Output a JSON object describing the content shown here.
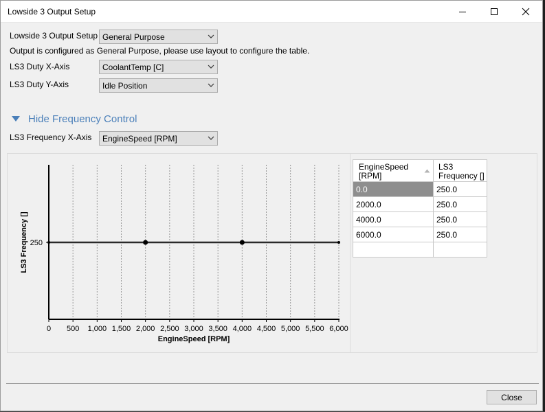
{
  "window": {
    "title": "Lowside 3 Output Setup"
  },
  "form": {
    "output_setup_label": "Lowside 3 Output Setup",
    "output_setup_value": "General Purpose",
    "info_text": "Output is configured as General Purpose, please use layout to configure the table.",
    "duty_x_label": "LS3 Duty X-Axis",
    "duty_x_value": "CoolantTemp [C]",
    "duty_y_label": "LS3 Duty Y-Axis",
    "duty_y_value": "Idle Position",
    "section_toggle_label": "Hide Frequency Control",
    "freq_x_label": "LS3 Frequency X-Axis",
    "freq_x_value": "EngineSpeed [RPM]"
  },
  "chart_data": {
    "type": "line",
    "x": [
      0,
      2000,
      4000,
      6000
    ],
    "series": [
      {
        "values": [
          250,
          250,
          250,
          250
        ]
      }
    ],
    "xlabel": "EngineSpeed [RPM]",
    "ylabel": "LS3 Frequency []",
    "xlim": [
      0,
      6000
    ],
    "xticks": [
      "0",
      "500",
      "1,000",
      "1,500",
      "2,000",
      "2,500",
      "3,000",
      "3,500",
      "4,000",
      "4,500",
      "5,000",
      "5,500",
      "6,000"
    ],
    "yticks": [
      "250"
    ],
    "grid": "vertical-dashed"
  },
  "table": {
    "col1_header_line1": "EngineSpeed",
    "col1_header_line2": "[RPM]",
    "col2_header_line1": "LS3",
    "col2_header_line2": "Frequency []",
    "rows": [
      {
        "rpm": "0.0",
        "freq": "250.0"
      },
      {
        "rpm": "2000.0",
        "freq": "250.0"
      },
      {
        "rpm": "4000.0",
        "freq": "250.0"
      },
      {
        "rpm": "6000.0",
        "freq": "250.0"
      }
    ]
  },
  "footer": {
    "close_label": "Close"
  },
  "icons": {
    "minimize": "minimize-icon",
    "maximize": "maximize-icon",
    "close": "close-icon",
    "dropdown": "chevron-down-icon",
    "collapse": "triangle-down-icon",
    "sort": "sort-arrow-icon"
  }
}
